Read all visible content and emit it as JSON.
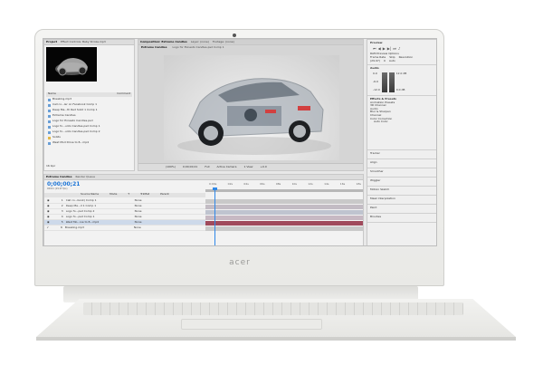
{
  "device": {
    "brand_logo": "acer"
  },
  "project_panel": {
    "tabs": [
      "Project",
      "Effect Controls: Baby Stroke.mp3"
    ],
    "columns": [
      "Name",
      "Comment"
    ],
    "items": [
      {
        "label": "Breaking.mp3",
        "type": "audio"
      },
      {
        "label": "Call co...ler on Facebook Comp 1",
        "type": "comp"
      },
      {
        "label": "Deep Ma...th Red Solid 1 Comp 1",
        "type": "comp"
      },
      {
        "label": "Extreme Candles",
        "type": "comp"
      },
      {
        "label": "Logo for Exnesto Candles.psd",
        "type": "image"
      },
      {
        "label": "Logo fo...unto Candles.psd Comp 1",
        "type": "comp"
      },
      {
        "label": "Logo fo...unto Candles.psd Comp 2",
        "type": "comp"
      },
      {
        "label": "Solids",
        "type": "folder"
      },
      {
        "label": "West Mod Drive to 8...mp4",
        "type": "video"
      }
    ],
    "footer": "16 bpc"
  },
  "composition_panel": {
    "tabs": [
      "Composition: Extreme Candles",
      "Layer: (none)",
      "Footage: (none)"
    ],
    "subtabs": [
      "Extreme Candles",
      "Logo for Exnesto Candles.psd Comp 1"
    ],
    "toolbar": [
      "(100%)",
      "0;00;00;21",
      "Full",
      "Active Camera",
      "1 View",
      "+0.0"
    ]
  },
  "right_panels": {
    "preview_header": "Preview",
    "preview_labels": [
      "RAM Preview Options",
      "Frame Rate",
      "Skip",
      "Resolution",
      "(29.97)",
      "0",
      "Auto"
    ],
    "audio_header": "Audio",
    "audio_values": [
      "0.0",
      "-6.0",
      "-12.0",
      "12.0 dB",
      "0.0 dB"
    ],
    "effects_header": "Effects & Presets",
    "effects_items": [
      "Animation Presets",
      "3D Channel",
      "Audio",
      "Blur & Sharpen",
      "Channel",
      "Color Correction",
      "Auto Color"
    ],
    "sections": [
      "Tracker",
      "Align",
      "Smoother",
      "Wiggler",
      "Motion Sketch",
      "Mask Interpolation",
      "Paint",
      "Brushes"
    ]
  },
  "timeline": {
    "tabs": [
      "Extreme Candles",
      "Render Queue"
    ],
    "timecode": "0;00;00;21",
    "timecode_sub": "00021 (29.97 fps)",
    "columns": [
      "Source Name",
      "Mode",
      "T",
      "TrkMat",
      "Parent"
    ],
    "ruler": [
      "0:00s",
      "02s",
      "04s",
      "06s",
      "08s",
      "10s",
      "12s",
      "14s",
      "16s",
      "18s"
    ],
    "layers": [
      {
        "num": "1",
        "name": "Call co...book) Comp 1",
        "parent": "None",
        "selected": false
      },
      {
        "num": "2",
        "name": "Deep Ma...d 1 Comp 1",
        "parent": "None",
        "selected": false
      },
      {
        "num": "3",
        "name": "Logo fo...psd Comp 2",
        "parent": "None",
        "selected": false
      },
      {
        "num": "4",
        "name": "Logo fo...psd Comp 1",
        "parent": "None",
        "selected": false
      },
      {
        "num": "5",
        "name": "West Mo...ive to 8...mp4",
        "parent": "None",
        "selected": true
      },
      {
        "num": "6",
        "name": "Breaking.mp3",
        "parent": "None",
        "selected": false
      }
    ]
  },
  "colors": {
    "accent": "#2f88e8",
    "layer_bar": "#b8a8b4",
    "layer_bar_selected": "#a04a5c"
  }
}
